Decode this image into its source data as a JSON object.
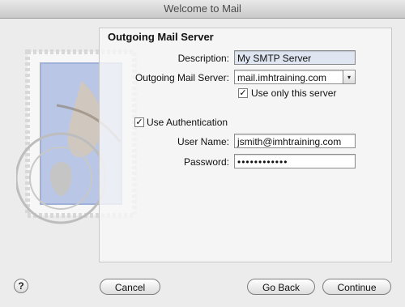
{
  "window": {
    "title": "Welcome to Mail"
  },
  "form": {
    "heading": "Outgoing Mail Server",
    "description_label": "Description:",
    "description_value": "My SMTP Server",
    "server_label": "Outgoing Mail Server:",
    "server_value": "mail.imhtraining.com",
    "use_only_label": "Use only this server",
    "use_only_checked": true,
    "use_auth_label": "Use Authentication",
    "use_auth_checked": true,
    "username_label": "User Name:",
    "username_value": "jsmith@imhtraining.com",
    "password_label": "Password:",
    "password_value": "••••••••••••"
  },
  "buttons": {
    "help": "?",
    "cancel": "Cancel",
    "back": "Go Back",
    "continue": "Continue"
  },
  "icons": {
    "combo_arrow": "▾",
    "checkmark": "✓"
  }
}
